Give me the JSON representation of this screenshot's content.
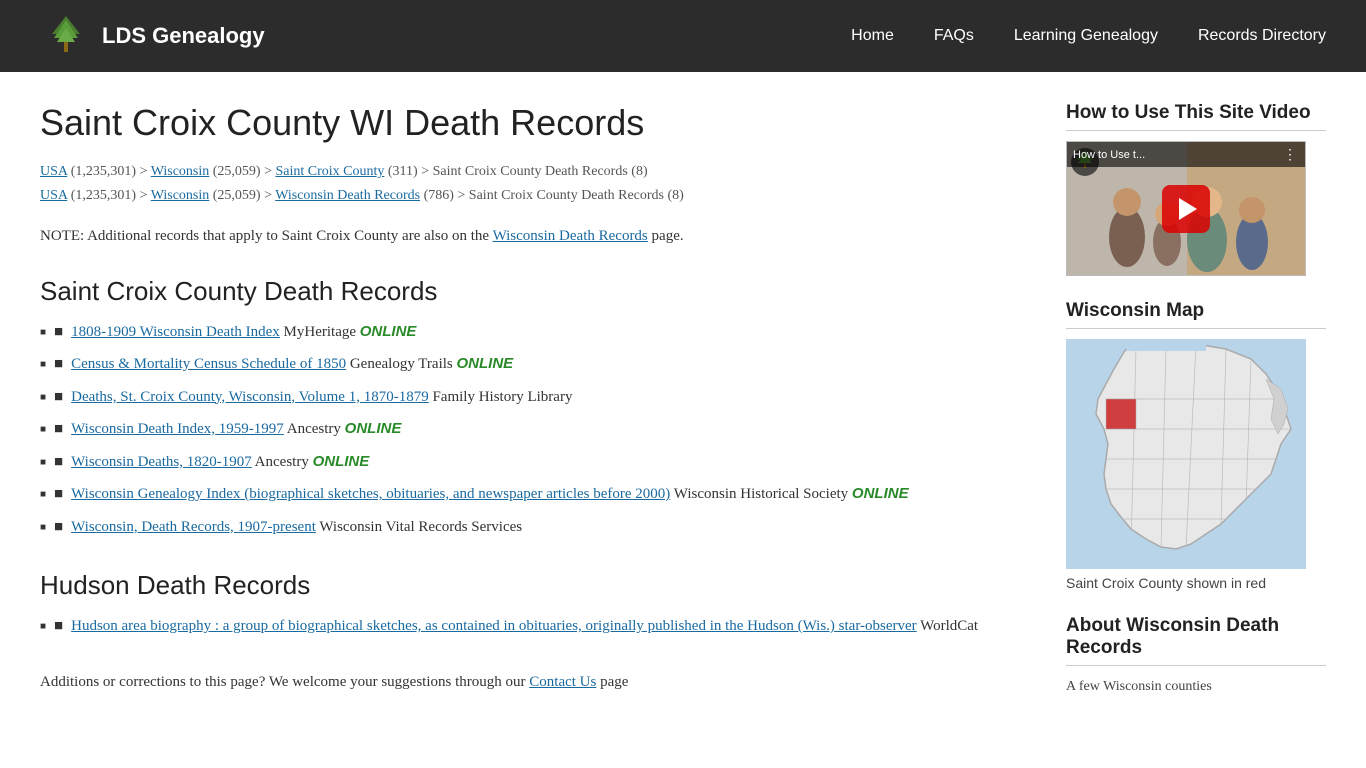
{
  "header": {
    "logo_text": "LDS Genealogy",
    "nav": {
      "home": "Home",
      "faqs": "FAQs",
      "learning": "Learning Genealogy",
      "records_dir": "Records Directory"
    }
  },
  "main": {
    "page_title": "Saint Croix County WI Death Records",
    "breadcrumbs": [
      {
        "line": "USA (1,235,301) > Wisconsin (25,059) > Saint Croix County (311) > Saint Croix County Death Records (8)",
        "links": [
          "USA",
          "Wisconsin",
          "Saint Croix County"
        ]
      },
      {
        "line": "USA (1,235,301) > Wisconsin (25,059) > Wisconsin Death Records (786) > Saint Croix County Death Records (8)",
        "links": [
          "USA",
          "Wisconsin",
          "Wisconsin Death Records"
        ]
      }
    ],
    "note": "NOTE: Additional records that apply to Saint Croix County are also on the Wisconsin Death Records page.",
    "section1_title": "Saint Croix County Death Records",
    "records": [
      {
        "link": "1808-1909 Wisconsin Death Index",
        "source": "MyHeritage",
        "online": true
      },
      {
        "link": "Census & Mortality Census Schedule of 1850",
        "source": "Genealogy Trails",
        "online": true
      },
      {
        "link": "Deaths, St. Croix County, Wisconsin, Volume 1, 1870-1879",
        "source": "Family History Library",
        "online": false
      },
      {
        "link": "Wisconsin Death Index, 1959-1997",
        "source": "Ancestry",
        "online": true
      },
      {
        "link": "Wisconsin Deaths, 1820-1907",
        "source": "Ancestry",
        "online": true
      },
      {
        "link": "Wisconsin Genealogy Index (biographical sketches, obituaries, and newspaper articles before 2000)",
        "source": "Wisconsin Historical Society",
        "online": true
      },
      {
        "link": "Wisconsin, Death Records, 1907-present",
        "source": "Wisconsin Vital Records Services",
        "online": false
      }
    ],
    "section2_title": "Hudson Death Records",
    "hudson_records": [
      {
        "link": "Hudson area biography : a group of biographical sketches, as contained in obituaries, originally published in the Hudson (Wis.) star-observer",
        "source": "WorldCat",
        "online": false
      }
    ],
    "corrections_text": "Additions or corrections to this page? We welcome your suggestions through our Contact Us page",
    "online_label": "ONLINE"
  },
  "sidebar": {
    "video_section_title": "How to Use This Site Video",
    "video_title": "How to Use t...",
    "map_section_title": "Wisconsin Map",
    "map_caption": "Saint Croix County shown in red",
    "about_section_title": "About Wisconsin Death Records",
    "about_text": "A few Wisconsin counties"
  }
}
